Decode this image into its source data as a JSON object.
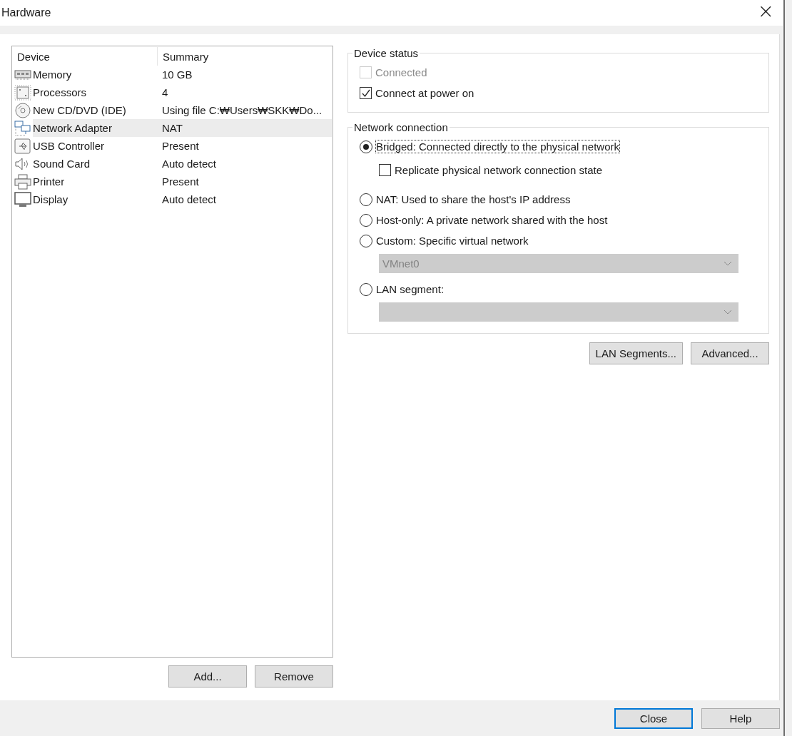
{
  "window": {
    "title": "Hardware",
    "close_glyph": "×"
  },
  "device_table": {
    "columns": [
      "Device",
      "Summary"
    ],
    "rows": [
      {
        "kind": "memory",
        "device": "Memory",
        "summary": "10 GB",
        "selected": false
      },
      {
        "kind": "processor",
        "device": "Processors",
        "summary": "4",
        "selected": false
      },
      {
        "kind": "disc",
        "device": "New CD/DVD (IDE)",
        "summary": "Using file C:₩Users₩SKK₩Do...",
        "selected": false
      },
      {
        "kind": "network",
        "device": "Network Adapter",
        "summary": "NAT",
        "selected": true
      },
      {
        "kind": "usb",
        "device": "USB Controller",
        "summary": "Present",
        "selected": false
      },
      {
        "kind": "sound",
        "device": "Sound Card",
        "summary": "Auto detect",
        "selected": false
      },
      {
        "kind": "printer",
        "device": "Printer",
        "summary": "Present",
        "selected": false
      },
      {
        "kind": "display",
        "device": "Display",
        "summary": "Auto detect",
        "selected": false
      }
    ]
  },
  "list_buttons": [
    "Add...",
    "Remove"
  ],
  "device_status": {
    "title": "Device status",
    "options": [
      {
        "label": "Connected",
        "checked": false,
        "disabled": true
      },
      {
        "label": "Connect at power on",
        "checked": true,
        "disabled": false
      }
    ]
  },
  "network_connection": {
    "title": "Network connection",
    "options": [
      {
        "kind": "radio",
        "label": "Bridged: Connected directly to the physical network",
        "selected": true,
        "focused": true
      },
      {
        "kind": "checkbox",
        "label": "Replicate physical network connection state",
        "checked": false
      },
      {
        "kind": "radio",
        "label": "NAT: Used to share the host's IP address",
        "selected": false,
        "focused": false
      },
      {
        "kind": "radio",
        "label": "Host-only: A private network shared with the host",
        "selected": false,
        "focused": false
      },
      {
        "kind": "radio",
        "label": "Custom: Specific virtual network",
        "selected": false,
        "focused": false
      },
      {
        "kind": "dropdown",
        "value": "VMnet0",
        "disabled": true
      },
      {
        "kind": "radio",
        "label": "LAN segment:",
        "selected": false,
        "focused": false
      },
      {
        "kind": "dropdown",
        "disabled": true
      }
    ]
  },
  "network_buttons": [
    "LAN Segments...",
    "Advanced..."
  ],
  "footer_buttons": [
    {
      "label": "Close",
      "selected": true
    },
    {
      "label": "Help",
      "selected": false
    }
  ]
}
